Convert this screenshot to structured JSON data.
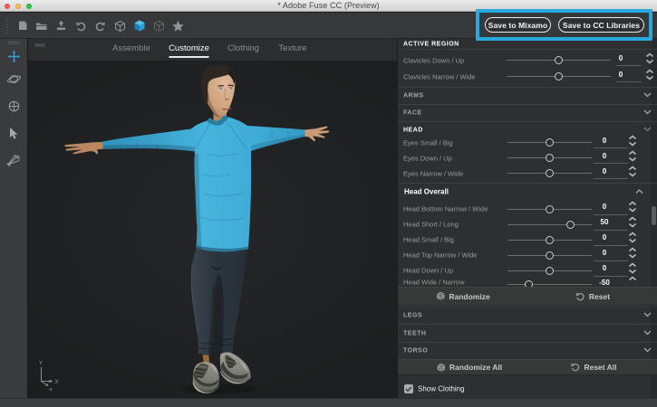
{
  "window": {
    "title": "* Adobe Fuse CC (Preview)",
    "traffic_lights": [
      "close",
      "minimize",
      "zoom"
    ]
  },
  "toolbar": {
    "icons": [
      "new-document",
      "open-folder",
      "import",
      "undo",
      "redo",
      "assemble-cube",
      "customize-cube",
      "ghost-cube",
      "favorites-star"
    ],
    "active_icon": "customize-cube",
    "active_icon_color": "#2a9fd8",
    "buttons": [
      {
        "label": "Save to Mixamo"
      },
      {
        "label": "Save to CC Libraries"
      }
    ],
    "annotation_color": "#27a9de"
  },
  "tabs": [
    {
      "label": "Assemble",
      "active": false
    },
    {
      "label": "Customize",
      "active": true
    },
    {
      "label": "Clothing",
      "active": false
    },
    {
      "label": "Texture",
      "active": false
    }
  ],
  "tool_sidebar": [
    {
      "name": "move-tool",
      "active": true,
      "color": "#2d9fd8"
    },
    {
      "name": "orbit-tool",
      "active": false
    },
    {
      "name": "pan-tool",
      "active": false
    },
    {
      "name": "select-tool",
      "active": false
    },
    {
      "name": "camera-tool",
      "active": false
    }
  ],
  "viewport": {
    "axis_labels": {
      "y": "Y",
      "x": "X",
      "z": "-z"
    },
    "model": "male character, T-pose, blue long-sleeve shirt, dark pants, gray sneakers"
  },
  "panel": {
    "active_region": {
      "header": "ACTIVE REGION",
      "sliders": [
        {
          "label": "Clavicles Down / Up",
          "value": "0"
        },
        {
          "label": "Clavicles Narrow / Wide",
          "value": "0"
        }
      ]
    },
    "groups_top": [
      {
        "label": "ARMS"
      },
      {
        "label": "FACE"
      }
    ],
    "head_group": {
      "label": "HEAD"
    },
    "head_sliders": [
      {
        "label": "Eyes Small / Big",
        "value": "0"
      },
      {
        "label": "Eyes Down / Up",
        "value": "0"
      },
      {
        "label": "Eyes Narrow / Wide",
        "value": "0"
      }
    ],
    "head_overall": {
      "label": "Head Overall",
      "sliders": [
        {
          "label": "Head Bottom Narrow / Wide",
          "value": "0"
        },
        {
          "label": "Head Short / Long",
          "value": "50"
        },
        {
          "label": "Head Small / Big",
          "value": "0"
        },
        {
          "label": "Head Top Narrow / Wide",
          "value": "0"
        },
        {
          "label": "Head Down / Up",
          "value": "0"
        },
        {
          "label": "Head Wide / Narrow",
          "value": "-50"
        }
      ]
    },
    "randomize_bar": {
      "randomize": "Randomize",
      "reset": "Reset"
    },
    "groups_bottom": [
      {
        "label": "LEGS"
      },
      {
        "label": "TEETH"
      },
      {
        "label": "TORSO"
      }
    ],
    "randomize_all_bar": {
      "randomize": "Randomize All",
      "reset": "Reset All"
    },
    "show_clothing": {
      "label": "Show Clothing",
      "checked": true
    }
  }
}
